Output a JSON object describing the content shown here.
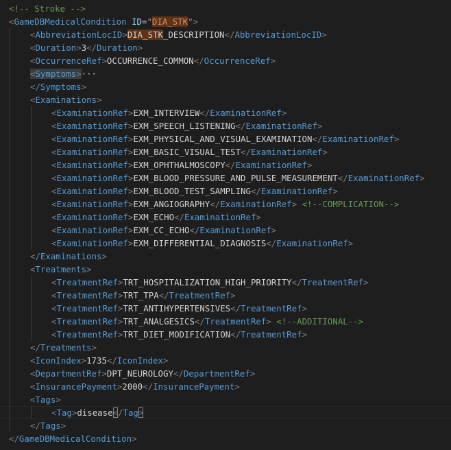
{
  "editor": {
    "lines": [
      {
        "indent": 0,
        "tokens": [
          {
            "t": "<!-- Stroke -->",
            "c": "cmt"
          }
        ]
      },
      {
        "indent": 0,
        "tokens": [
          {
            "t": "<",
            "c": "br"
          },
          {
            "t": "GameDBMedicalCondition",
            "c": "tag"
          },
          {
            "t": " ",
            "c": "txt"
          },
          {
            "t": "ID",
            "c": "attr"
          },
          {
            "t": "=",
            "c": "txt"
          },
          {
            "t": "\"",
            "c": "val"
          },
          {
            "t": "DIA_STK",
            "c": "val hl"
          },
          {
            "t": "\"",
            "c": "val"
          },
          {
            "t": ">",
            "c": "br"
          }
        ]
      },
      {
        "indent": 1,
        "tokens": [
          {
            "t": "<",
            "c": "br"
          },
          {
            "t": "AbbreviationLocID",
            "c": "tag"
          },
          {
            "t": ">",
            "c": "br"
          },
          {
            "t": "DIA_STK",
            "c": "txt hl"
          },
          {
            "t": "_DESCRIPTION",
            "c": "txt"
          },
          {
            "t": "</",
            "c": "br"
          },
          {
            "t": "AbbreviationLocID",
            "c": "tag"
          },
          {
            "t": ">",
            "c": "br"
          }
        ]
      },
      {
        "indent": 1,
        "tokens": [
          {
            "t": "<",
            "c": "br"
          },
          {
            "t": "Duration",
            "c": "tag"
          },
          {
            "t": ">",
            "c": "br"
          },
          {
            "t": "3",
            "c": "txt"
          },
          {
            "t": "</",
            "c": "br"
          },
          {
            "t": "Duration",
            "c": "tag"
          },
          {
            "t": ">",
            "c": "br"
          }
        ]
      },
      {
        "indent": 1,
        "tokens": [
          {
            "t": "<",
            "c": "br"
          },
          {
            "t": "OccurrenceRef",
            "c": "tag"
          },
          {
            "t": ">",
            "c": "br"
          },
          {
            "t": "OCCURRENCE_COMMON",
            "c": "txt"
          },
          {
            "t": "</",
            "c": "br"
          },
          {
            "t": "OccurrenceRef",
            "c": "tag"
          },
          {
            "t": ">",
            "c": "br"
          }
        ]
      },
      {
        "indent": 1,
        "folded": true,
        "tokens": [
          {
            "t": "<",
            "c": "br hlsoft"
          },
          {
            "t": "Symptoms",
            "c": "tag hlsoft"
          },
          {
            "t": ">",
            "c": "br hlsoft"
          },
          {
            "t": "···",
            "c": "fold"
          }
        ]
      },
      {
        "indent": 1,
        "tokens": [
          {
            "t": "</",
            "c": "br"
          },
          {
            "t": "Symptoms",
            "c": "tag"
          },
          {
            "t": ">",
            "c": "br"
          }
        ]
      },
      {
        "indent": 1,
        "tokens": [
          {
            "t": "<",
            "c": "br"
          },
          {
            "t": "Examinations",
            "c": "tag"
          },
          {
            "t": ">",
            "c": "br"
          }
        ]
      },
      {
        "indent": 2,
        "tokens": [
          {
            "t": "<",
            "c": "br"
          },
          {
            "t": "ExaminationRef",
            "c": "tag"
          },
          {
            "t": ">",
            "c": "br"
          },
          {
            "t": "EXM_INTERVIEW",
            "c": "txt"
          },
          {
            "t": "</",
            "c": "br"
          },
          {
            "t": "ExaminationRef",
            "c": "tag"
          },
          {
            "t": ">",
            "c": "br"
          }
        ]
      },
      {
        "indent": 2,
        "tokens": [
          {
            "t": "<",
            "c": "br"
          },
          {
            "t": "ExaminationRef",
            "c": "tag"
          },
          {
            "t": ">",
            "c": "br"
          },
          {
            "t": "EXM_SPEECH_LISTENING",
            "c": "txt"
          },
          {
            "t": "</",
            "c": "br"
          },
          {
            "t": "ExaminationRef",
            "c": "tag"
          },
          {
            "t": ">",
            "c": "br"
          }
        ]
      },
      {
        "indent": 2,
        "tokens": [
          {
            "t": "<",
            "c": "br"
          },
          {
            "t": "ExaminationRef",
            "c": "tag"
          },
          {
            "t": ">",
            "c": "br"
          },
          {
            "t": "EXM_PHYSICAL_AND_VISUAL_EXAMINATION",
            "c": "txt"
          },
          {
            "t": "</",
            "c": "br"
          },
          {
            "t": "ExaminationRef",
            "c": "tag"
          },
          {
            "t": ">",
            "c": "br"
          }
        ]
      },
      {
        "indent": 2,
        "tokens": [
          {
            "t": "<",
            "c": "br"
          },
          {
            "t": "ExaminationRef",
            "c": "tag"
          },
          {
            "t": ">",
            "c": "br"
          },
          {
            "t": "EXM_BASIC_VISUAL_TEST",
            "c": "txt"
          },
          {
            "t": "</",
            "c": "br"
          },
          {
            "t": "ExaminationRef",
            "c": "tag"
          },
          {
            "t": ">",
            "c": "br"
          }
        ]
      },
      {
        "indent": 2,
        "tokens": [
          {
            "t": "<",
            "c": "br"
          },
          {
            "t": "ExaminationRef",
            "c": "tag"
          },
          {
            "t": ">",
            "c": "br"
          },
          {
            "t": "EXM_OPHTHALMOSCOPY",
            "c": "txt"
          },
          {
            "t": "</",
            "c": "br"
          },
          {
            "t": "ExaminationRef",
            "c": "tag"
          },
          {
            "t": ">",
            "c": "br"
          }
        ]
      },
      {
        "indent": 2,
        "tokens": [
          {
            "t": "<",
            "c": "br"
          },
          {
            "t": "ExaminationRef",
            "c": "tag"
          },
          {
            "t": ">",
            "c": "br"
          },
          {
            "t": "EXM_BLOOD_PRESSURE_AND_PULSE_MEASUREMENT",
            "c": "txt"
          },
          {
            "t": "</",
            "c": "br"
          },
          {
            "t": "ExaminationRef",
            "c": "tag"
          },
          {
            "t": ">",
            "c": "br"
          }
        ]
      },
      {
        "indent": 2,
        "tokens": [
          {
            "t": "<",
            "c": "br"
          },
          {
            "t": "ExaminationRef",
            "c": "tag"
          },
          {
            "t": ">",
            "c": "br"
          },
          {
            "t": "EXM_BLOOD_TEST_SAMPLING",
            "c": "txt"
          },
          {
            "t": "</",
            "c": "br"
          },
          {
            "t": "ExaminationRef",
            "c": "tag"
          },
          {
            "t": ">",
            "c": "br"
          }
        ]
      },
      {
        "indent": 2,
        "tokens": [
          {
            "t": "<",
            "c": "br"
          },
          {
            "t": "ExaminationRef",
            "c": "tag"
          },
          {
            "t": ">",
            "c": "br"
          },
          {
            "t": "EXM_ANGIOGRAPHY",
            "c": "txt"
          },
          {
            "t": "</",
            "c": "br"
          },
          {
            "t": "ExaminationRef",
            "c": "tag"
          },
          {
            "t": ">",
            "c": "br"
          },
          {
            "t": " ",
            "c": "txt"
          },
          {
            "t": "<!--COMPLICATION-->",
            "c": "cmt"
          }
        ]
      },
      {
        "indent": 2,
        "tokens": [
          {
            "t": "<",
            "c": "br"
          },
          {
            "t": "ExaminationRef",
            "c": "tag"
          },
          {
            "t": ">",
            "c": "br"
          },
          {
            "t": "EXM_ECHO",
            "c": "txt"
          },
          {
            "t": "</",
            "c": "br"
          },
          {
            "t": "ExaminationRef",
            "c": "tag"
          },
          {
            "t": ">",
            "c": "br"
          }
        ]
      },
      {
        "indent": 2,
        "tokens": [
          {
            "t": "<",
            "c": "br"
          },
          {
            "t": "ExaminationRef",
            "c": "tag"
          },
          {
            "t": ">",
            "c": "br"
          },
          {
            "t": "EXM_CC_ECHO",
            "c": "txt"
          },
          {
            "t": "</",
            "c": "br"
          },
          {
            "t": "ExaminationRef",
            "c": "tag"
          },
          {
            "t": ">",
            "c": "br"
          }
        ]
      },
      {
        "indent": 2,
        "tokens": [
          {
            "t": "<",
            "c": "br"
          },
          {
            "t": "ExaminationRef",
            "c": "tag"
          },
          {
            "t": ">",
            "c": "br"
          },
          {
            "t": "EXM_DIFFERENTIAL_DIAGNOSIS",
            "c": "txt"
          },
          {
            "t": "</",
            "c": "br"
          },
          {
            "t": "ExaminationRef",
            "c": "tag"
          },
          {
            "t": ">",
            "c": "br"
          }
        ]
      },
      {
        "indent": 1,
        "tokens": [
          {
            "t": "</",
            "c": "br"
          },
          {
            "t": "Examinations",
            "c": "tag"
          },
          {
            "t": ">",
            "c": "br"
          }
        ]
      },
      {
        "indent": 1,
        "tokens": [
          {
            "t": "<",
            "c": "br"
          },
          {
            "t": "Treatments",
            "c": "tag"
          },
          {
            "t": ">",
            "c": "br"
          }
        ]
      },
      {
        "indent": 2,
        "tokens": [
          {
            "t": "<",
            "c": "br"
          },
          {
            "t": "TreatmentRef",
            "c": "tag"
          },
          {
            "t": ">",
            "c": "br"
          },
          {
            "t": "TRT_HOSPITALIZATION_HIGH_PRIORITY",
            "c": "txt"
          },
          {
            "t": "</",
            "c": "br"
          },
          {
            "t": "TreatmentRef",
            "c": "tag"
          },
          {
            "t": ">",
            "c": "br"
          }
        ]
      },
      {
        "indent": 2,
        "tokens": [
          {
            "t": "<",
            "c": "br"
          },
          {
            "t": "TreatmentRef",
            "c": "tag"
          },
          {
            "t": ">",
            "c": "br"
          },
          {
            "t": "TRT_TPA",
            "c": "txt"
          },
          {
            "t": "</",
            "c": "br"
          },
          {
            "t": "TreatmentRef",
            "c": "tag"
          },
          {
            "t": ">",
            "c": "br"
          }
        ]
      },
      {
        "indent": 2,
        "tokens": [
          {
            "t": "<",
            "c": "br"
          },
          {
            "t": "TreatmentRef",
            "c": "tag"
          },
          {
            "t": ">",
            "c": "br"
          },
          {
            "t": "TRT_ANTIHYPERTENSIVES",
            "c": "txt"
          },
          {
            "t": "</",
            "c": "br"
          },
          {
            "t": "TreatmentRef",
            "c": "tag"
          },
          {
            "t": ">",
            "c": "br"
          }
        ]
      },
      {
        "indent": 2,
        "tokens": [
          {
            "t": "<",
            "c": "br"
          },
          {
            "t": "TreatmentRef",
            "c": "tag"
          },
          {
            "t": ">",
            "c": "br"
          },
          {
            "t": "TRT_ANALGESICS",
            "c": "txt"
          },
          {
            "t": "</",
            "c": "br"
          },
          {
            "t": "TreatmentRef",
            "c": "tag"
          },
          {
            "t": ">",
            "c": "br"
          },
          {
            "t": " ",
            "c": "txt"
          },
          {
            "t": "<!--ADDITIONAL-->",
            "c": "cmt"
          }
        ]
      },
      {
        "indent": 2,
        "tokens": [
          {
            "t": "<",
            "c": "br"
          },
          {
            "t": "TreatmentRef",
            "c": "tag"
          },
          {
            "t": ">",
            "c": "br"
          },
          {
            "t": "TRT_DIET_MODIFICATION",
            "c": "txt"
          },
          {
            "t": "</",
            "c": "br"
          },
          {
            "t": "TreatmentRef",
            "c": "tag"
          },
          {
            "t": ">",
            "c": "br"
          }
        ]
      },
      {
        "indent": 1,
        "tokens": [
          {
            "t": "</",
            "c": "br"
          },
          {
            "t": "Treatments",
            "c": "tag"
          },
          {
            "t": ">",
            "c": "br"
          }
        ]
      },
      {
        "indent": 1,
        "tokens": [
          {
            "t": "<",
            "c": "br"
          },
          {
            "t": "IconIndex",
            "c": "tag"
          },
          {
            "t": ">",
            "c": "br"
          },
          {
            "t": "1735",
            "c": "txt"
          },
          {
            "t": "</",
            "c": "br"
          },
          {
            "t": "IconIndex",
            "c": "tag"
          },
          {
            "t": ">",
            "c": "br"
          }
        ]
      },
      {
        "indent": 1,
        "tokens": [
          {
            "t": "<",
            "c": "br"
          },
          {
            "t": "DepartmentRef",
            "c": "tag"
          },
          {
            "t": ">",
            "c": "br"
          },
          {
            "t": "DPT_NEUROLOGY",
            "c": "txt"
          },
          {
            "t": "</",
            "c": "br"
          },
          {
            "t": "DepartmentRef",
            "c": "tag"
          },
          {
            "t": ">",
            "c": "br"
          }
        ]
      },
      {
        "indent": 1,
        "tokens": [
          {
            "t": "<",
            "c": "br"
          },
          {
            "t": "InsurancePayment",
            "c": "tag"
          },
          {
            "t": ">",
            "c": "br"
          },
          {
            "t": "2000",
            "c": "txt"
          },
          {
            "t": "</",
            "c": "br"
          },
          {
            "t": "InsurancePayment",
            "c": "tag"
          },
          {
            "t": ">",
            "c": "br"
          }
        ]
      },
      {
        "indent": 1,
        "tokens": [
          {
            "t": "<",
            "c": "br"
          },
          {
            "t": "Tags",
            "c": "tag"
          },
          {
            "t": ">",
            "c": "br"
          }
        ]
      },
      {
        "indent": 2,
        "cursor": true,
        "tokens": [
          {
            "t": "<",
            "c": "br"
          },
          {
            "t": "Tag",
            "c": "tag"
          },
          {
            "t": ">",
            "c": "br"
          },
          {
            "t": "disease",
            "c": "txt"
          },
          {
            "t": "<",
            "c": "br bmatch"
          },
          {
            "t": "/",
            "c": "br"
          },
          {
            "t": "Tag",
            "c": "tag"
          },
          {
            "t": ">",
            "c": "br bmatch"
          }
        ]
      },
      {
        "indent": 1,
        "tokens": [
          {
            "t": "</",
            "c": "br"
          },
          {
            "t": "Tags",
            "c": "tag"
          },
          {
            "t": ">",
            "c": "br"
          }
        ]
      },
      {
        "indent": 0,
        "tokens": [
          {
            "t": "</",
            "c": "br"
          },
          {
            "t": "GameDBMedicalCondition",
            "c": "tag"
          },
          {
            "t": ">",
            "c": "br"
          }
        ]
      }
    ]
  }
}
